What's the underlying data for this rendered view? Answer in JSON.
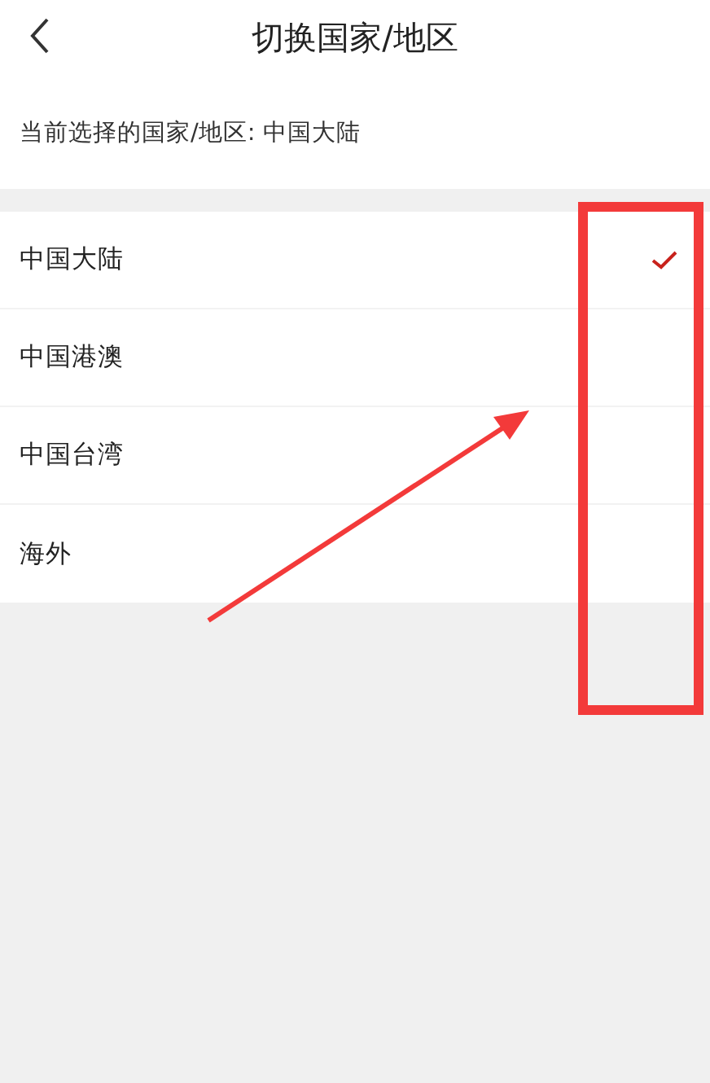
{
  "header": {
    "title": "切换国家/地区"
  },
  "current": {
    "text": "当前选择的国家/地区: 中国大陆"
  },
  "regions": [
    {
      "label": "中国大陆",
      "selected": true
    },
    {
      "label": "中国港澳",
      "selected": false
    },
    {
      "label": "中国台湾",
      "selected": false
    },
    {
      "label": "海外",
      "selected": false
    }
  ]
}
